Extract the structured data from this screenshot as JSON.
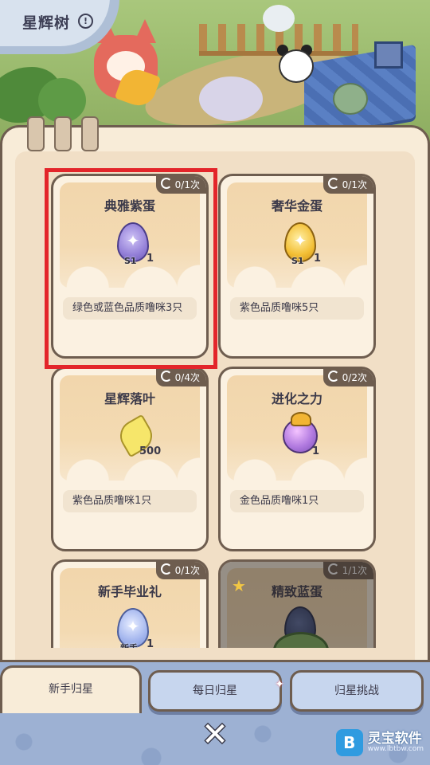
{
  "header": {
    "title": "星辉树",
    "info_icon": "info-icon"
  },
  "cards": [
    {
      "name": "典雅紫蛋",
      "count": "0/1次",
      "reward_qty": "1",
      "reward_tag": "S1",
      "egg": "purple",
      "requirement": "绿色或蓝色品质噜咪3只"
    },
    {
      "name": "奢华金蛋",
      "count": "0/1次",
      "reward_qty": "1",
      "reward_tag": "S1",
      "egg": "gold",
      "requirement": "紫色品质噜咪5只"
    },
    {
      "name": "星辉落叶",
      "count": "0/4次",
      "reward_qty": "500",
      "requirement": "紫色品质噜咪1只"
    },
    {
      "name": "进化之力",
      "count": "0/2次",
      "reward_qty": "1",
      "requirement": "金色品质噜咪1只"
    },
    {
      "name": "新手毕业礼",
      "count": "0/1次",
      "reward_qty": "1",
      "reward_tag": "新手",
      "egg": "blue"
    },
    {
      "name": "精致蓝蛋",
      "count": "1/1次",
      "locked": true
    }
  ],
  "tabs": [
    {
      "label": "新手归星",
      "active": true
    },
    {
      "label": "每日归星",
      "active": false
    },
    {
      "label": "归星挑战",
      "active": false
    }
  ],
  "close_label": "✕",
  "watermark": {
    "name": "灵宝软件",
    "url": "www.lbtbw.com"
  }
}
